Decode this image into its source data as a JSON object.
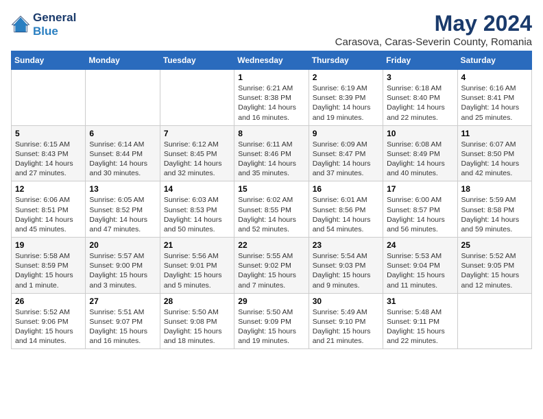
{
  "logo": {
    "line1": "General",
    "line2": "Blue"
  },
  "title": "May 2024",
  "subtitle": "Carasova, Caras-Severin County, Romania",
  "weekdays": [
    "Sunday",
    "Monday",
    "Tuesday",
    "Wednesday",
    "Thursday",
    "Friday",
    "Saturday"
  ],
  "weeks": [
    [
      {
        "day": "",
        "detail": ""
      },
      {
        "day": "",
        "detail": ""
      },
      {
        "day": "",
        "detail": ""
      },
      {
        "day": "1",
        "detail": "Sunrise: 6:21 AM\nSunset: 8:38 PM\nDaylight: 14 hours\nand 16 minutes."
      },
      {
        "day": "2",
        "detail": "Sunrise: 6:19 AM\nSunset: 8:39 PM\nDaylight: 14 hours\nand 19 minutes."
      },
      {
        "day": "3",
        "detail": "Sunrise: 6:18 AM\nSunset: 8:40 PM\nDaylight: 14 hours\nand 22 minutes."
      },
      {
        "day": "4",
        "detail": "Sunrise: 6:16 AM\nSunset: 8:41 PM\nDaylight: 14 hours\nand 25 minutes."
      }
    ],
    [
      {
        "day": "5",
        "detail": "Sunrise: 6:15 AM\nSunset: 8:43 PM\nDaylight: 14 hours\nand 27 minutes."
      },
      {
        "day": "6",
        "detail": "Sunrise: 6:14 AM\nSunset: 8:44 PM\nDaylight: 14 hours\nand 30 minutes."
      },
      {
        "day": "7",
        "detail": "Sunrise: 6:12 AM\nSunset: 8:45 PM\nDaylight: 14 hours\nand 32 minutes."
      },
      {
        "day": "8",
        "detail": "Sunrise: 6:11 AM\nSunset: 8:46 PM\nDaylight: 14 hours\nand 35 minutes."
      },
      {
        "day": "9",
        "detail": "Sunrise: 6:09 AM\nSunset: 8:47 PM\nDaylight: 14 hours\nand 37 minutes."
      },
      {
        "day": "10",
        "detail": "Sunrise: 6:08 AM\nSunset: 8:49 PM\nDaylight: 14 hours\nand 40 minutes."
      },
      {
        "day": "11",
        "detail": "Sunrise: 6:07 AM\nSunset: 8:50 PM\nDaylight: 14 hours\nand 42 minutes."
      }
    ],
    [
      {
        "day": "12",
        "detail": "Sunrise: 6:06 AM\nSunset: 8:51 PM\nDaylight: 14 hours\nand 45 minutes."
      },
      {
        "day": "13",
        "detail": "Sunrise: 6:05 AM\nSunset: 8:52 PM\nDaylight: 14 hours\nand 47 minutes."
      },
      {
        "day": "14",
        "detail": "Sunrise: 6:03 AM\nSunset: 8:53 PM\nDaylight: 14 hours\nand 50 minutes."
      },
      {
        "day": "15",
        "detail": "Sunrise: 6:02 AM\nSunset: 8:55 PM\nDaylight: 14 hours\nand 52 minutes."
      },
      {
        "day": "16",
        "detail": "Sunrise: 6:01 AM\nSunset: 8:56 PM\nDaylight: 14 hours\nand 54 minutes."
      },
      {
        "day": "17",
        "detail": "Sunrise: 6:00 AM\nSunset: 8:57 PM\nDaylight: 14 hours\nand 56 minutes."
      },
      {
        "day": "18",
        "detail": "Sunrise: 5:59 AM\nSunset: 8:58 PM\nDaylight: 14 hours\nand 59 minutes."
      }
    ],
    [
      {
        "day": "19",
        "detail": "Sunrise: 5:58 AM\nSunset: 8:59 PM\nDaylight: 15 hours\nand 1 minute."
      },
      {
        "day": "20",
        "detail": "Sunrise: 5:57 AM\nSunset: 9:00 PM\nDaylight: 15 hours\nand 3 minutes."
      },
      {
        "day": "21",
        "detail": "Sunrise: 5:56 AM\nSunset: 9:01 PM\nDaylight: 15 hours\nand 5 minutes."
      },
      {
        "day": "22",
        "detail": "Sunrise: 5:55 AM\nSunset: 9:02 PM\nDaylight: 15 hours\nand 7 minutes."
      },
      {
        "day": "23",
        "detail": "Sunrise: 5:54 AM\nSunset: 9:03 PM\nDaylight: 15 hours\nand 9 minutes."
      },
      {
        "day": "24",
        "detail": "Sunrise: 5:53 AM\nSunset: 9:04 PM\nDaylight: 15 hours\nand 11 minutes."
      },
      {
        "day": "25",
        "detail": "Sunrise: 5:52 AM\nSunset: 9:05 PM\nDaylight: 15 hours\nand 12 minutes."
      }
    ],
    [
      {
        "day": "26",
        "detail": "Sunrise: 5:52 AM\nSunset: 9:06 PM\nDaylight: 15 hours\nand 14 minutes."
      },
      {
        "day": "27",
        "detail": "Sunrise: 5:51 AM\nSunset: 9:07 PM\nDaylight: 15 hours\nand 16 minutes."
      },
      {
        "day": "28",
        "detail": "Sunrise: 5:50 AM\nSunset: 9:08 PM\nDaylight: 15 hours\nand 18 minutes."
      },
      {
        "day": "29",
        "detail": "Sunrise: 5:50 AM\nSunset: 9:09 PM\nDaylight: 15 hours\nand 19 minutes."
      },
      {
        "day": "30",
        "detail": "Sunrise: 5:49 AM\nSunset: 9:10 PM\nDaylight: 15 hours\nand 21 minutes."
      },
      {
        "day": "31",
        "detail": "Sunrise: 5:48 AM\nSunset: 9:11 PM\nDaylight: 15 hours\nand 22 minutes."
      },
      {
        "day": "",
        "detail": ""
      }
    ]
  ]
}
